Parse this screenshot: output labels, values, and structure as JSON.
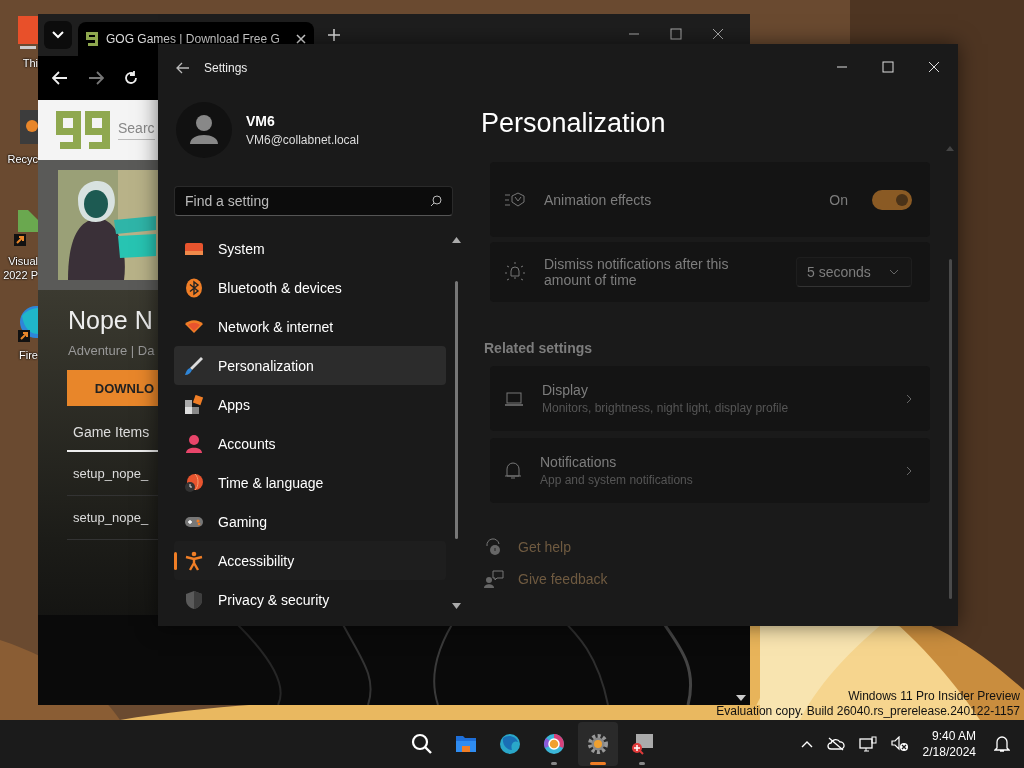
{
  "desktop": {
    "icons": [
      {
        "label_lines": [
          "Thi"
        ]
      },
      {
        "label_lines": [
          "Recyc"
        ]
      },
      {
        "label_lines": [
          "Visual",
          "2022 P"
        ]
      },
      {
        "label_lines": [
          "Fire"
        ]
      }
    ]
  },
  "browser": {
    "tab_title": "GOG Games | Download Free G",
    "search_placeholder": "Searc",
    "game_title": "Nope N",
    "game_meta": "Adventure | Da",
    "download_button": "DOWNLO",
    "page_tabs": [
      {
        "label": "Game Items",
        "selected": true
      }
    ],
    "files": [
      "setup_nope_",
      "setup_nope_"
    ]
  },
  "settings": {
    "window_title": "Settings",
    "user": {
      "name": "VM6",
      "email": "VM6@collabnet.local"
    },
    "search": {
      "placeholder": "Find a setting"
    },
    "nav_items": [
      {
        "label": "System",
        "selected": false,
        "hovered": false
      },
      {
        "label": "Bluetooth & devices",
        "selected": false,
        "hovered": false
      },
      {
        "label": "Network & internet",
        "selected": false,
        "hovered": false
      },
      {
        "label": "Personalization",
        "selected": false,
        "hovered": true
      },
      {
        "label": "Apps",
        "selected": false,
        "hovered": false
      },
      {
        "label": "Accounts",
        "selected": false,
        "hovered": false
      },
      {
        "label": "Time & language",
        "selected": false,
        "hovered": false
      },
      {
        "label": "Gaming",
        "selected": false,
        "hovered": false
      },
      {
        "label": "Accessibility",
        "selected": true,
        "hovered": false
      },
      {
        "label": "Privacy & security",
        "selected": false,
        "hovered": false
      }
    ],
    "page_title": "Personalization",
    "rows": [
      {
        "kind": "toggle",
        "label": "Animation effects",
        "state_text": "On",
        "on": true
      },
      {
        "kind": "dropdown",
        "label": "Dismiss notifications after this amount of time",
        "value": "5 seconds"
      }
    ],
    "related_heading": "Related settings",
    "related": [
      {
        "title": "Display",
        "subtitle": "Monitors, brightness, night light, display profile"
      },
      {
        "title": "Notifications",
        "subtitle": "App and system notifications"
      }
    ],
    "help_links": [
      "Get help",
      "Give feedback"
    ]
  },
  "watermark": [
    "Windows 11 Pro Insider Preview",
    "Evaluation copy. Build 26040.rs_prerelease.240122-1157"
  ],
  "taskbar": {
    "apps": [
      {
        "running": false,
        "selected": false
      },
      {
        "running": false,
        "selected": false
      },
      {
        "running": false,
        "selected": false
      },
      {
        "running": true,
        "selected": false
      },
      {
        "running": true,
        "selected": true
      },
      {
        "running": true,
        "selected": false
      }
    ],
    "time": "9:40 AM",
    "date": "2/18/2024"
  }
}
